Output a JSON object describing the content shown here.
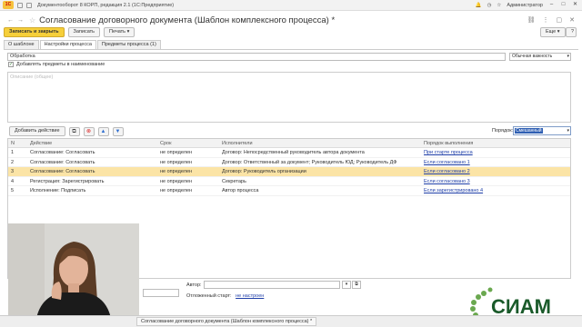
{
  "titlebar": {
    "app_title": "Документооборот 8 КОРП, редакция 2.1  (1С:Предприятие)",
    "user": "Администратор"
  },
  "header": {
    "doc_title": "Согласование договорного документа (Шаблон комплексного процесса) *"
  },
  "toolbar": {
    "save_close": "Записать и закрыть",
    "save": "Записать",
    "print": "Печать",
    "more": "Еще",
    "help": "?"
  },
  "tabs": [
    {
      "label": "О шаблоне"
    },
    {
      "label": "Настройки процесса"
    },
    {
      "label": "Предметы процесса (1)"
    }
  ],
  "form": {
    "name_value": "Обработка",
    "importance_value": "Обычная важность",
    "add_subjects_label": "Добавлять предметы в наименование",
    "description_placeholder": "Описание (общее)"
  },
  "list_toolbar": {
    "add_action": "Добавить действие",
    "order_label": "Порядок:",
    "order_value": "Смешанный"
  },
  "table": {
    "headers": [
      "N",
      "Действие",
      "Срок",
      "Исполнители",
      "Порядок выполнения"
    ],
    "rows": [
      {
        "n": "1",
        "action": "Согласование: Согласовать",
        "term": "не определен",
        "performers": "Договор: Непосредственный руководитель автора документа",
        "order": "При старте процесса"
      },
      {
        "n": "2",
        "action": "Согласование: Согласовать",
        "term": "не определен",
        "performers": "Договор: Ответственный за документ; Руководитель ЮД; Руководитель ДФ",
        "order": "Если согласовано 1"
      },
      {
        "n": "3",
        "action": "Согласование: Согласовать",
        "term": "не определен",
        "performers": "Договор: Руководитель организации",
        "order": "Если согласовано 2"
      },
      {
        "n": "4",
        "action": "Регистрация: Зарегистрировать",
        "term": "не определен",
        "performers": "Секретарь",
        "order": "Если согласовано 3"
      },
      {
        "n": "5",
        "action": "Исполнение: Подписать",
        "term": "не определен",
        "performers": "Автор процесса",
        "order": "Если зарегистрировано 4"
      }
    ]
  },
  "bottom": {
    "author_label": "Автор:",
    "defer_label": "Отложенный старт:",
    "defer_value": "не настроен"
  },
  "brand": {
    "logo_text": "СИАМ"
  },
  "taskbar": {
    "item": "Согласование договорного документа (Шаблон комплексного процесса) *"
  }
}
